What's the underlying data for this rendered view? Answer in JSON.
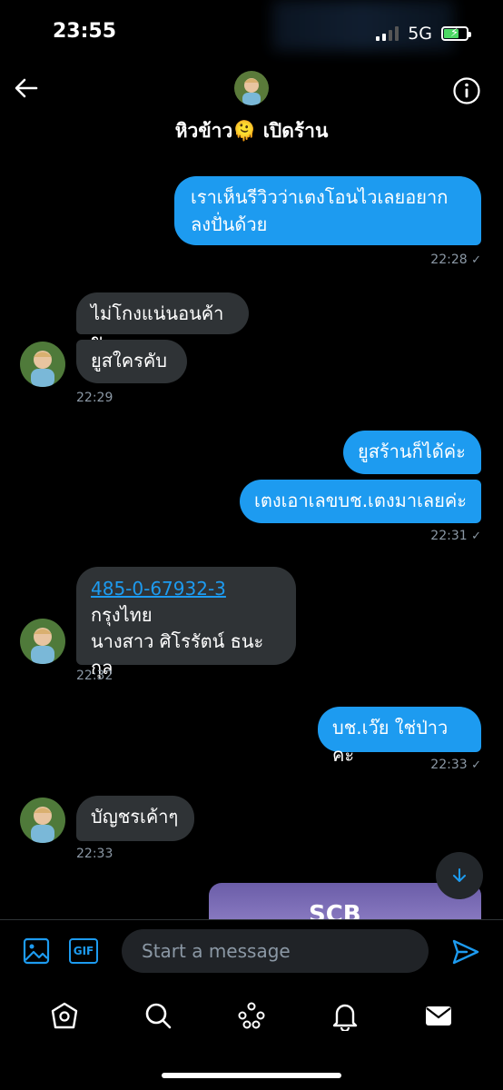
{
  "status_bar": {
    "time": "23:55",
    "network": "5G"
  },
  "header": {
    "title": "หิวข้าว",
    "emoji": "🫠",
    "title_suffix": "เปิดร้าน"
  },
  "messages": {
    "m1": {
      "text": "เราเห็นรีวิวว่าเตงโอนไวเลยอยากลงปั่นด้วย",
      "time": "22:28"
    },
    "m2": {
      "text": "ไม่โกงแน่นอนค้าข"
    },
    "m3": {
      "text": "ยูสใครคับ",
      "time": "22:29"
    },
    "m4": {
      "text": "ยูสร้านก็ได้ค่ะ"
    },
    "m5": {
      "text": "เตงเอาเลขบช.เตงมาเลยค่ะ",
      "time": "22:31"
    },
    "m6": {
      "account_number": "485-0-67932-3",
      "bank": "กรุงไทย",
      "name": "นางสาว ศิโรรัตน์ ธนะกุล",
      "time": "22:32"
    },
    "m7": {
      "text": "บช.เว๊ย ใช่ป่าวคะ",
      "time": "22:33"
    },
    "m8": {
      "text": "บัญชรเค้าๆ",
      "time": "22:33"
    },
    "m9": {
      "logo_text": "SCB"
    }
  },
  "composer": {
    "placeholder": "Start a message",
    "gif_label": "GIF"
  },
  "colors": {
    "outgoing": "#1d9bf0",
    "incoming": "#2f3336",
    "background": "#000000"
  }
}
